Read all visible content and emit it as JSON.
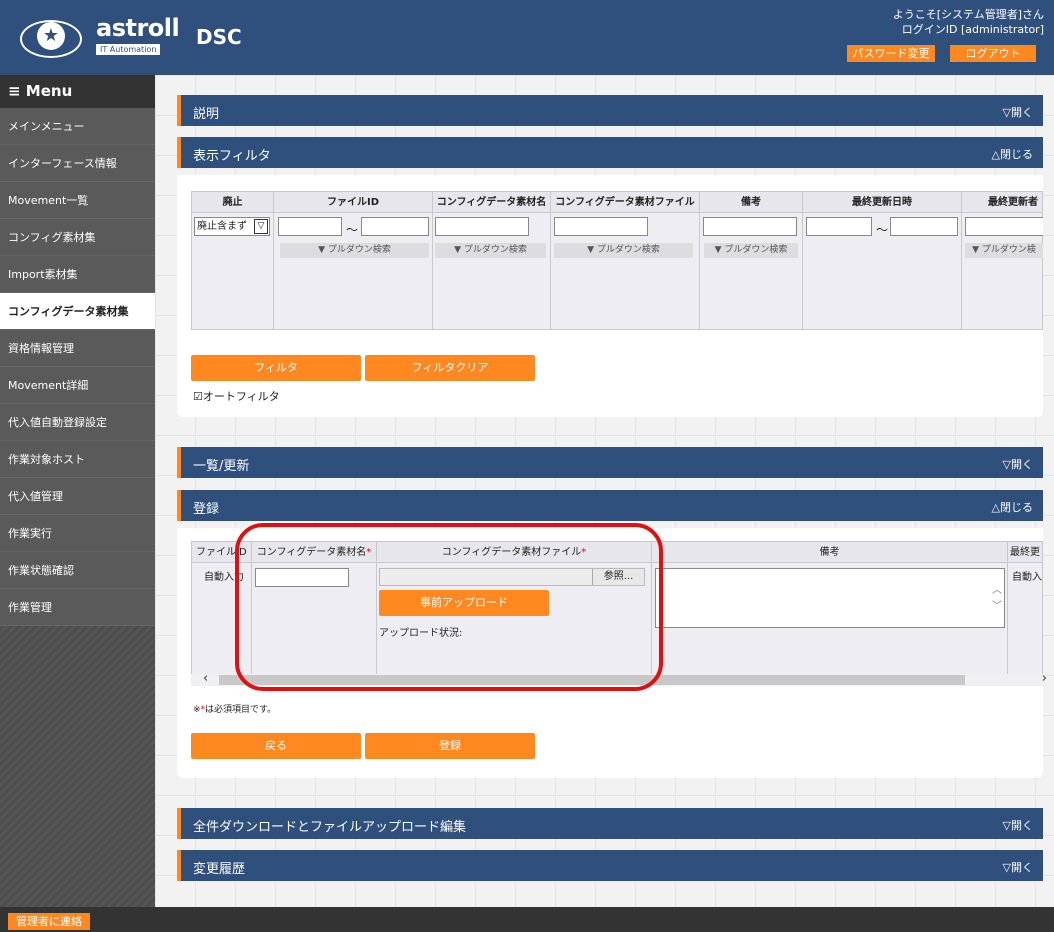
{
  "header": {
    "brand": "astroll",
    "brand_sub": "IT Automation",
    "app_title": "DSC",
    "welcome_line1": "ようこそ[システム管理者]さん",
    "welcome_line2": "ログインID [administrator]",
    "password_button": "パスワード変更",
    "logout_button": "ログアウト"
  },
  "sidebar": {
    "title": "≡ Menu",
    "items": [
      {
        "label": "メインメニュー"
      },
      {
        "label": "インターフェース情報"
      },
      {
        "label": "Movement一覧"
      },
      {
        "label": "コンフィグ素材集"
      },
      {
        "label": "Import素材集"
      },
      {
        "label": "コンフィグデータ素材集"
      },
      {
        "label": "資格情報管理"
      },
      {
        "label": "Movement詳細"
      },
      {
        "label": "代入値自動登録設定"
      },
      {
        "label": "作業対象ホスト"
      },
      {
        "label": "代入値管理"
      },
      {
        "label": "作業実行"
      },
      {
        "label": "作業状態確認"
      },
      {
        "label": "作業管理"
      }
    ]
  },
  "sections": {
    "description": {
      "title": "説明",
      "toggle": "▽開く"
    },
    "filter": {
      "title": "表示フィルタ",
      "toggle": "△閉じる"
    },
    "list": {
      "title": "一覧/更新",
      "toggle": "▽開く"
    },
    "register": {
      "title": "登録",
      "toggle": "△閉じる"
    },
    "bulk": {
      "title": "全件ダウンロードとファイルアップロード編集",
      "toggle": "▽開く"
    },
    "history": {
      "title": "変更履歴",
      "toggle": "▽開く"
    }
  },
  "filter": {
    "headers": [
      "廃止",
      "ファイルID",
      "コンフィグデータ素材名",
      "コンフィグデータ素材ファイル",
      "備考",
      "最終更新日時",
      "最終更新者"
    ],
    "discard_select": "廃止含まず",
    "tilde": "～",
    "pulldown": "▼ プルダウン検索",
    "pulldown_cut": "▼ プルダウン検",
    "filter_button": "フィルタ",
    "clear_button": "フィルタクリア",
    "auto_filter": "☑オートフィルタ"
  },
  "register": {
    "headers": {
      "file_id": "ファイルID",
      "name": "コンフィグデータ素材名",
      "file": "コンフィグデータ素材ファイル",
      "note": "備考",
      "last": "最終更"
    },
    "required_mark": "*",
    "auto_input": "自動入力",
    "auto_input_cut": "自動入",
    "browse_button": "参照...",
    "pre_upload_button": "事前アップロード",
    "upload_status": "アップロード状況:",
    "required_note_prefix": "※",
    "required_note_suffix": "は必須項目です。",
    "back_button": "戻る",
    "submit_button": "登録"
  },
  "footer": {
    "contact_button": "管理者に連絡"
  },
  "colors": {
    "header_bg": "#2f4f7d",
    "accent": "#ff8820",
    "highlight": "#e01010"
  }
}
